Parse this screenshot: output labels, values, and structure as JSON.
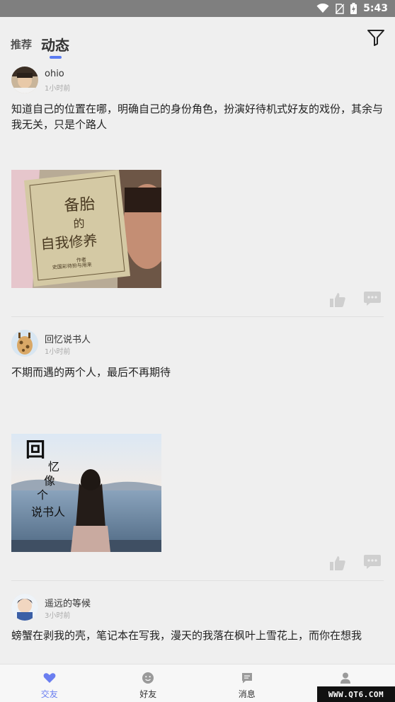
{
  "status_bar": {
    "time": "5:43"
  },
  "header": {
    "tabs": [
      {
        "label": "推荐"
      },
      {
        "label": "动态"
      }
    ],
    "active_tab": 1,
    "accent": "#5b7cf2"
  },
  "posts": [
    {
      "user": "ohio",
      "time": "1小时前",
      "text": "知道自己的位置在哪，明确自己的身份角色，扮演好待机式好友的戏份，其余与我无关，只是个路人",
      "image": {
        "title_lines": [
          "备胎",
          "的",
          "自我修养"
        ],
        "footer_lines": [
          "作者",
          "史国彩待扮与用来"
        ]
      }
    },
    {
      "user": "回忆说书人",
      "time": "1小时前",
      "text": "不期而遇的两个人，最后不再期待",
      "image": {
        "title_lines": [
          "回",
          "忆",
          "像",
          "个",
          "说书人"
        ]
      }
    },
    {
      "user": "遥远的等候",
      "time": "3小时前",
      "text": "螃蟹在剥我的壳，笔记本在写我，漫天的我落在枫叶上雪花上，而你在想我"
    }
  ],
  "tabbar": {
    "items": [
      {
        "label": "交友",
        "icon": "heart-icon"
      },
      {
        "label": "好友",
        "icon": "smile-icon"
      },
      {
        "label": "消息",
        "icon": "message-icon"
      },
      {
        "label": "",
        "icon": "user-icon"
      }
    ],
    "active": 0,
    "active_color": "#6a7ef0"
  },
  "watermark": "WWW.QT6.COM"
}
